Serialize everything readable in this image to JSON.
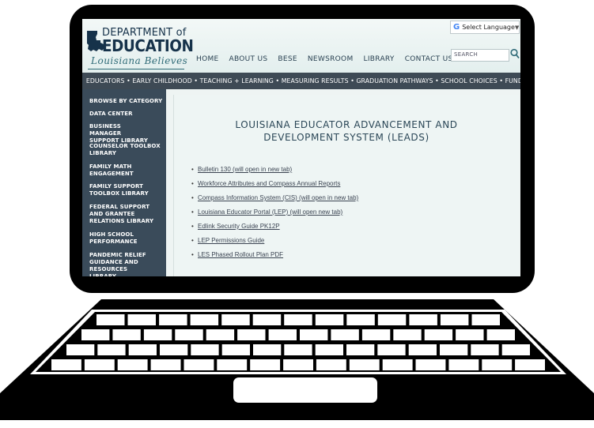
{
  "header": {
    "logo": {
      "department": "DEPARTMENT of",
      "education": "EDUCATION",
      "tagline": "Louisiana Believes"
    },
    "nav": [
      "HOME",
      "ABOUT US",
      "BESE",
      "NEWSROOM",
      "LIBRARY",
      "CONTACT US"
    ],
    "language_label": "Select Language",
    "search_placeholder": "SEARCH"
  },
  "topnav": {
    "text": "EDUCATORS • EARLY CHILDHOOD • TEACHING + LEARNING • MEASURING RESULTS • GRADUATION PATHWAYS • SCHOOL CHOICES • FUNDING"
  },
  "sidebar": {
    "items": [
      "BROWSE BY CATEGORY",
      "DATA CENTER",
      "BUSINESS MANAGER SUPPORT LIBRARY",
      "COUNSELOR TOOLBOX LIBRARY",
      "FAMILY MATH ENGAGEMENT",
      "FAMILY SUPPORT TOOLBOX LIBRARY",
      "FEDERAL SUPPORT AND GRANTEE RELATIONS LIBRARY",
      "HIGH SCHOOL PERFORMANCE",
      "PANDEMIC RELIEF GUIDANCE AND RESOURCES LIBRARY"
    ]
  },
  "main": {
    "title": "LOUISIANA EDUCATOR ADVANCEMENT AND DEVELOPMENT SYSTEM (LEADS)",
    "links": [
      "Bulletin 130 (will open in new tab)",
      "Workforce Attributes and Compass Annual Reports",
      "Compass Information System (CIS) (will open in new tab)",
      "Louisiana Educator Portal (LEP) (will open new tab)",
      "Edlink Security Guide PK12P",
      "LEP Permissions Guide",
      "LES Phased Rollout Plan PDF"
    ]
  },
  "colors": {
    "laptop": "#000000",
    "navbar": "#3e4a55",
    "sidebar": "#3a4b5a",
    "content_bg": "#eef5f4"
  }
}
